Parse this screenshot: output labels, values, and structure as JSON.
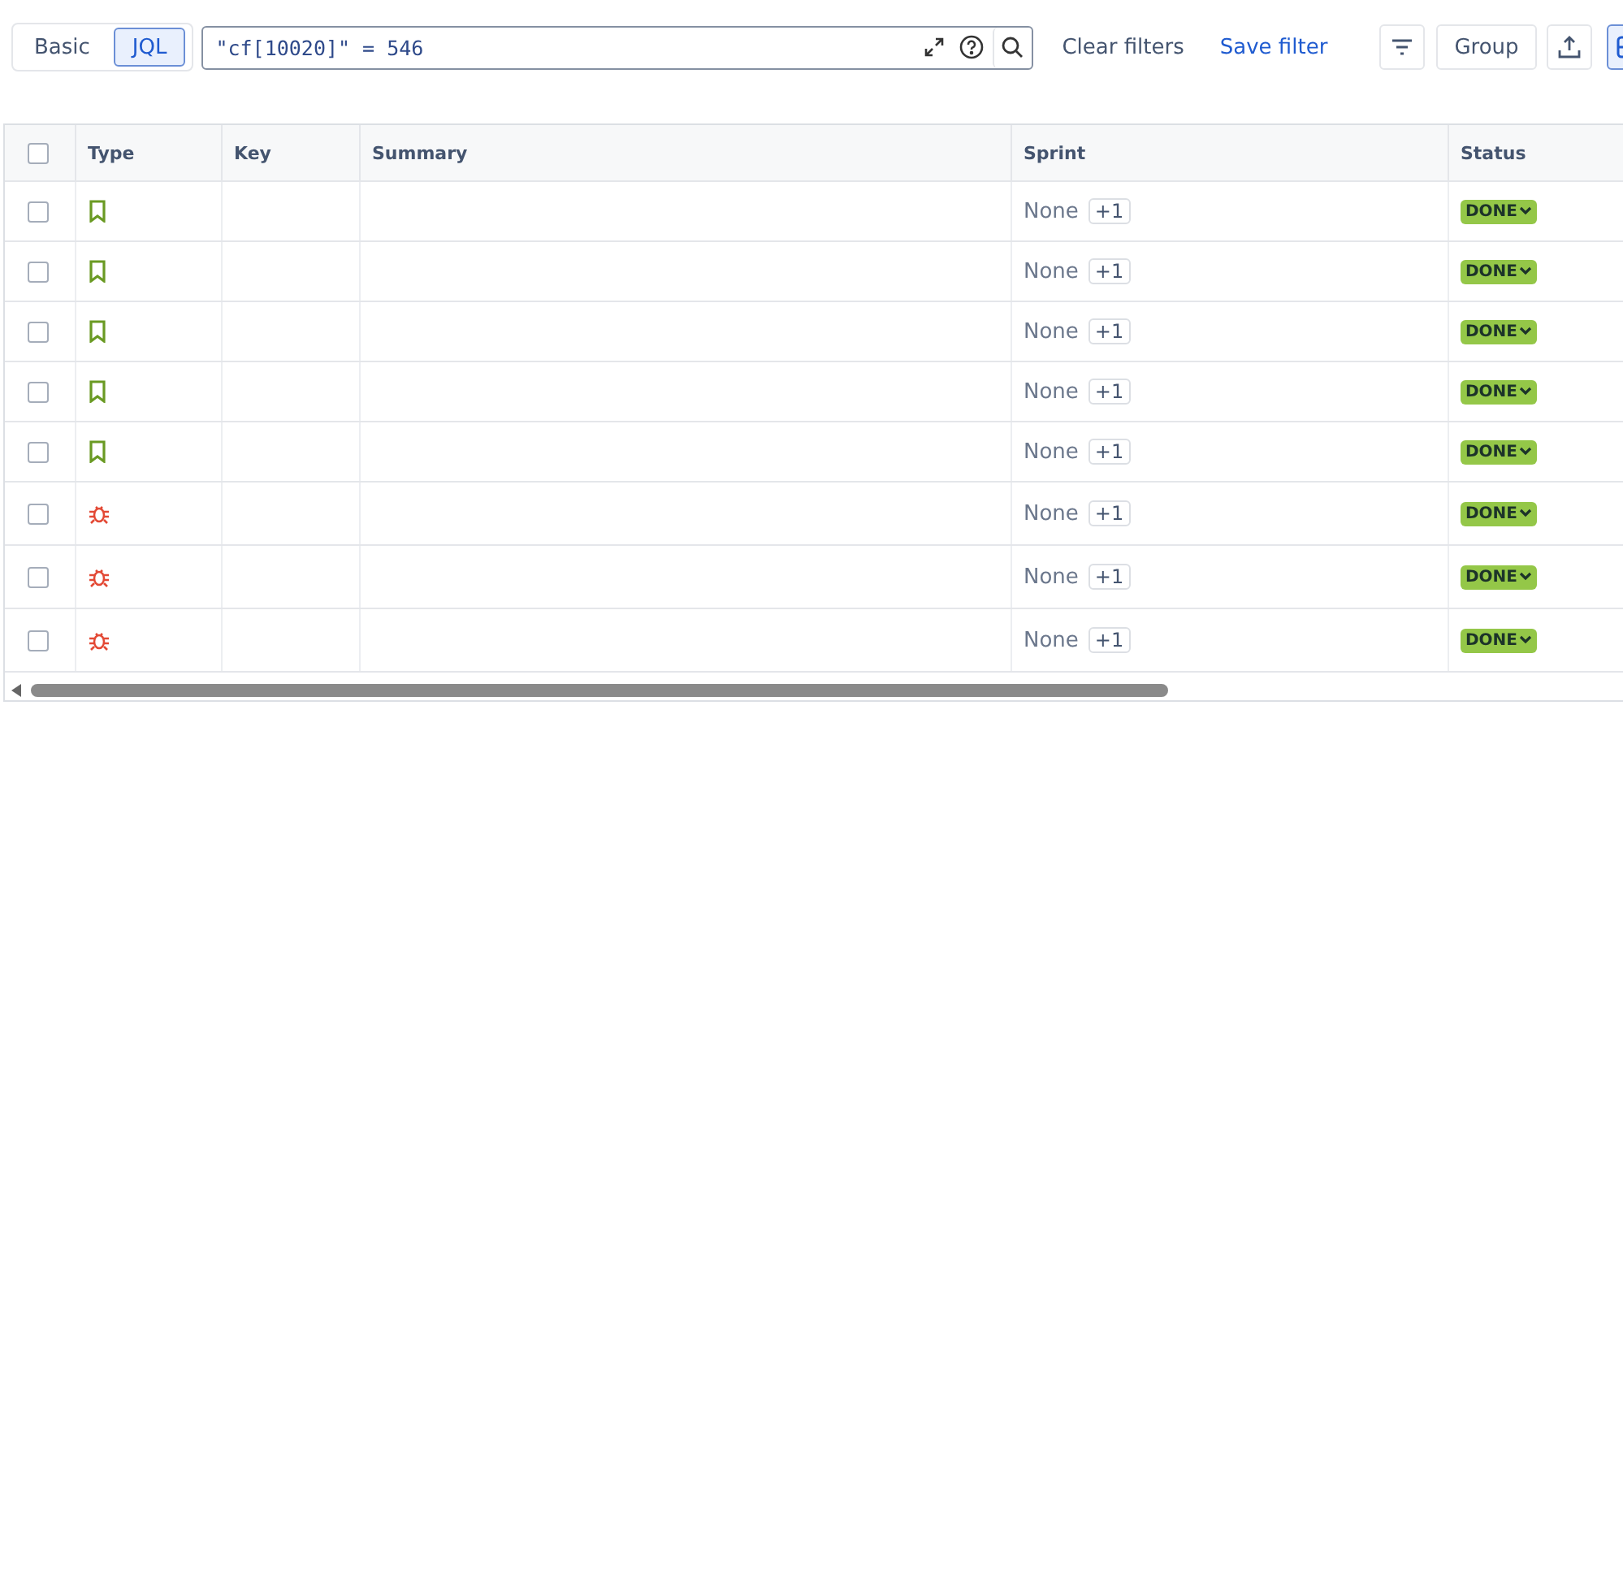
{
  "modes": [
    {
      "label": "Basic",
      "selected": false
    },
    {
      "label": "JQL",
      "selected": true
    }
  ],
  "query": {
    "value": "\"cf[10020]\" = 546"
  },
  "actions": {
    "clear": "Clear filters",
    "save": "Save filter",
    "group": "Group"
  },
  "table": {
    "all_checked": false,
    "columns": [
      "Type",
      "Key",
      "Summary",
      "Sprint",
      "Status"
    ],
    "rows": [
      {
        "kind": "story",
        "checked": false,
        "sprint": "None",
        "sprint_extra": "+1",
        "status": "DONE"
      },
      {
        "kind": "story",
        "checked": false,
        "sprint": "None",
        "sprint_extra": "+1",
        "status": "DONE"
      },
      {
        "kind": "story",
        "checked": false,
        "sprint": "None",
        "sprint_extra": "+1",
        "status": "DONE"
      },
      {
        "kind": "story",
        "checked": false,
        "sprint": "None",
        "sprint_extra": "+1",
        "status": "DONE"
      },
      {
        "kind": "story",
        "checked": false,
        "sprint": "None",
        "sprint_extra": "+1",
        "status": "DONE"
      },
      {
        "kind": "bug",
        "checked": false,
        "sprint": "None",
        "sprint_extra": "+1",
        "status": "DONE"
      },
      {
        "kind": "bug",
        "checked": false,
        "sprint": "None",
        "sprint_extra": "+1",
        "status": "DONE"
      },
      {
        "kind": "bug",
        "checked": false,
        "sprint": "None",
        "sprint_extra": "+1",
        "status": "DONE"
      }
    ]
  }
}
